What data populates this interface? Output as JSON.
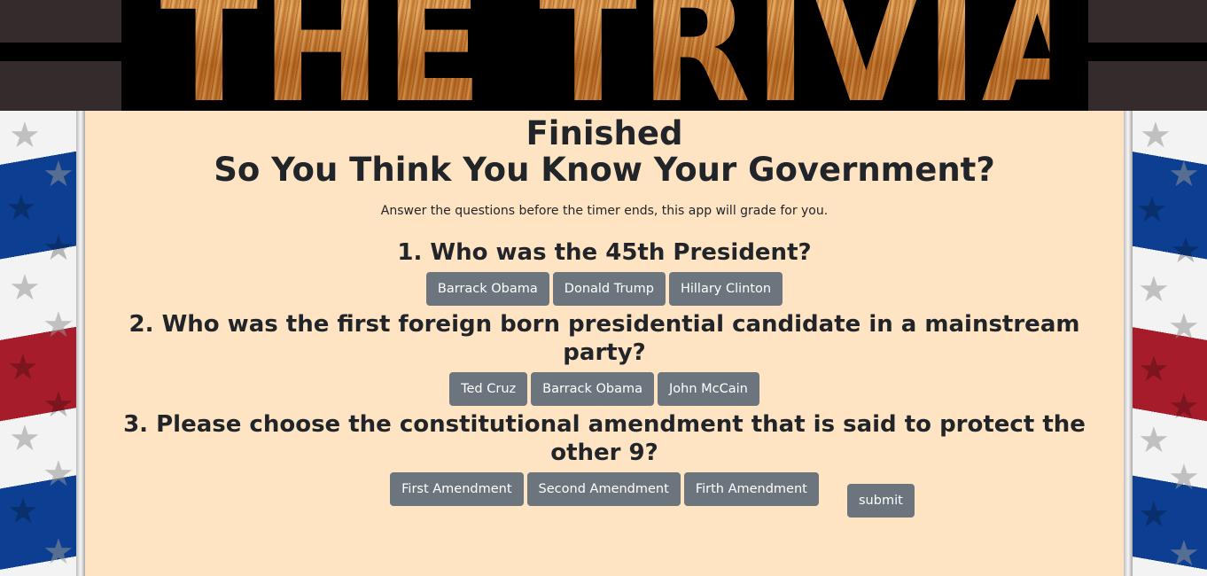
{
  "banner": {
    "text": "THE TRIVIA GAME"
  },
  "status": "Finished",
  "title": "So You Think You Know Your Government?",
  "subtitle": "Answer the questions before the timer ends, this app will grade for you.",
  "questions": [
    {
      "text": "1. Who was the 45th President?",
      "answers": [
        "Barrack Obama",
        "Donald Trump",
        "Hillary Clinton"
      ]
    },
    {
      "text": "2. Who was the first foreign born presidential candidate in a mainstream party?",
      "answers": [
        "Ted Cruz",
        "Barrack Obama",
        "John McCain"
      ]
    },
    {
      "text": "3. Please choose the constitutional amendment that is said to protect the other 9?",
      "answers": [
        "First Amendment",
        "Second Amendment",
        "Firth Amendment"
      ]
    }
  ],
  "submit_label": "submit",
  "icons": {
    "side_decoration": "star-icon"
  },
  "colors": {
    "background": "#ffe4c4",
    "button": "#6c757d",
    "flag_blue": "#0c3f91",
    "flag_red": "#a61c2a",
    "header": "#342c2c"
  }
}
